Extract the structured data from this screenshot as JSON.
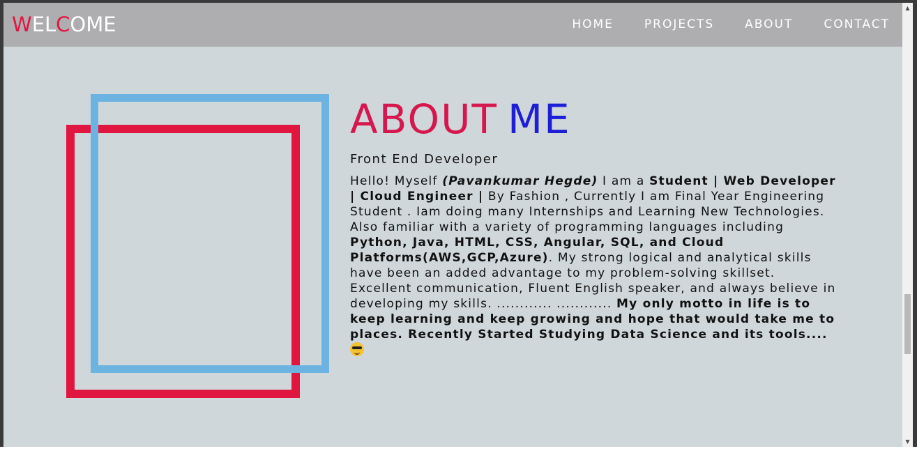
{
  "nav": {
    "brand_parts": [
      "W",
      "EL",
      "C",
      "OME"
    ],
    "links": [
      "HOME",
      "PROJECTS",
      "ABOUT",
      "CONTACT"
    ]
  },
  "about": {
    "title_part1": "ABOUT",
    "title_part2": "ME",
    "subtitle": "Front End Developer",
    "body": [
      {
        "t": "Hello! Myself ",
        "s": "n"
      },
      {
        "t": "(Pavankumar Hegde)",
        "s": "i"
      },
      {
        "t": " I am a ",
        "s": "n"
      },
      {
        "t": "Student | Web Developer | Cloud Engineer |",
        "s": "b"
      },
      {
        "t": " By Fashion , Currently I am Final Year Engineering Student . Iam doing many Internships and Learning New Technologies. Also familiar with a variety of programming languages including ",
        "s": "n"
      },
      {
        "t": "Python, Java, HTML, CSS, Angular, SQL, and Cloud Platforms(AWS,GCP,Azure)",
        "s": "b"
      },
      {
        "t": ". My strong logical and analytical skills have been an added advantage to my problem-solving skillset. Excellent communication, Fluent English speaker, and always believe in developing my skills. ............ ............ ",
        "s": "n"
      },
      {
        "t": "My only motto in life is to keep learning and keep growing and hope that would take me to places. Recently Started Studying Data Science and its tools....",
        "s": "b"
      }
    ],
    "emoji_icon": "sunglasses-emoji-icon"
  },
  "colors": {
    "brand_accent": "#e11640",
    "title_red": "#d6174d",
    "title_blue": "#1d1fd6",
    "frame_red": "#e11640",
    "frame_blue": "#6db3e2",
    "nav_bg": "#aeaeb0",
    "page_bg": "#cfd7db"
  }
}
